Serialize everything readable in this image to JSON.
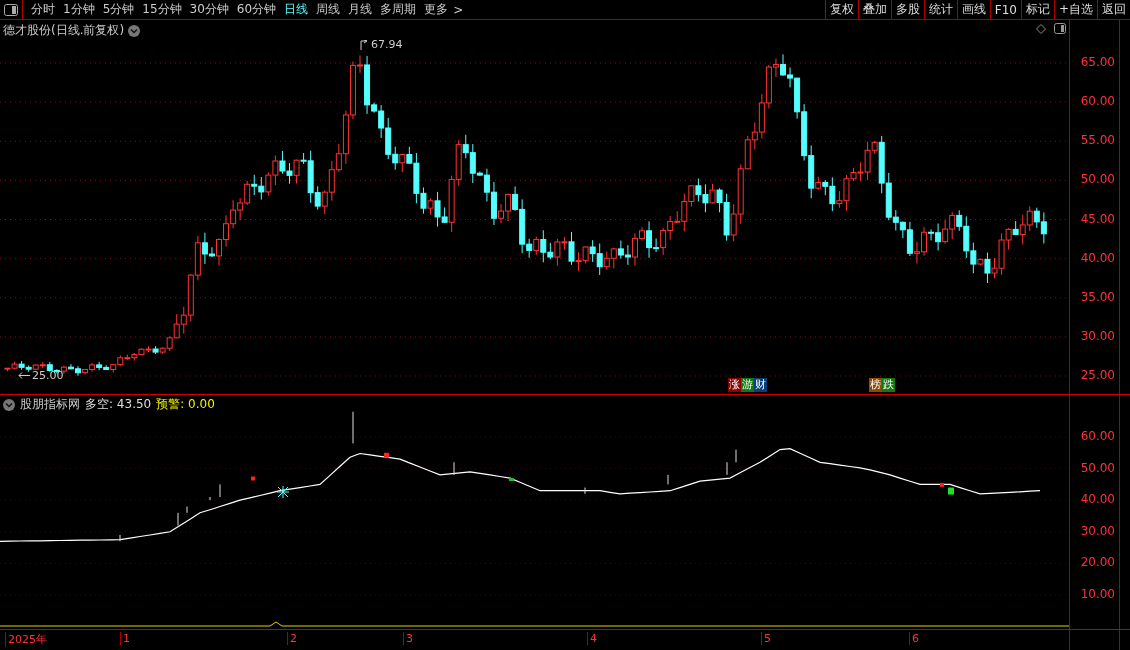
{
  "toolbar": {
    "periods": [
      {
        "label": "分时",
        "selected": false
      },
      {
        "label": "1分钟",
        "selected": false
      },
      {
        "label": "5分钟",
        "selected": false
      },
      {
        "label": "15分钟",
        "selected": false
      },
      {
        "label": "30分钟",
        "selected": false
      },
      {
        "label": "60分钟",
        "selected": false
      },
      {
        "label": "日线",
        "selected": true
      },
      {
        "label": "周线",
        "selected": false
      },
      {
        "label": "月线",
        "selected": false
      },
      {
        "label": "多周期",
        "selected": false
      },
      {
        "label": "更多",
        "selected": false
      }
    ],
    "more_caret": ">",
    "buttons": [
      "复权",
      "叠加",
      "多股",
      "统计",
      "画线",
      "F10",
      "标记",
      "+自选",
      "返回"
    ]
  },
  "price_pane": {
    "title": "德才股份(日线.前复权)",
    "high_marker": "67.94",
    "low_marker": "25.00",
    "axis_labels": [
      "65.00",
      "60.00",
      "55.00",
      "50.00",
      "45.00",
      "40.00",
      "35.00",
      "30.00",
      "25.00"
    ],
    "tags": [
      [
        {
          "label": "涨",
          "color": "#8b0000"
        },
        {
          "label": "游",
          "color": "#117711"
        },
        {
          "label": "财",
          "color": "#0a3c78"
        }
      ],
      [
        {
          "label": "榜",
          "color": "#8a4a00"
        },
        {
          "label": "跌",
          "color": "#117711"
        }
      ]
    ]
  },
  "indicator_pane": {
    "name": "股朋指标网",
    "main_label": "多空:",
    "main_value": "43.50",
    "alert_label": "预警:",
    "alert_value": "0.00",
    "axis_labels": [
      "60.00",
      "50.00",
      "40.00",
      "30.00",
      "20.00",
      "10.00"
    ]
  },
  "date_axis": [
    "2025年",
    "1",
    "2",
    "3",
    "4",
    "5",
    "6"
  ]
}
